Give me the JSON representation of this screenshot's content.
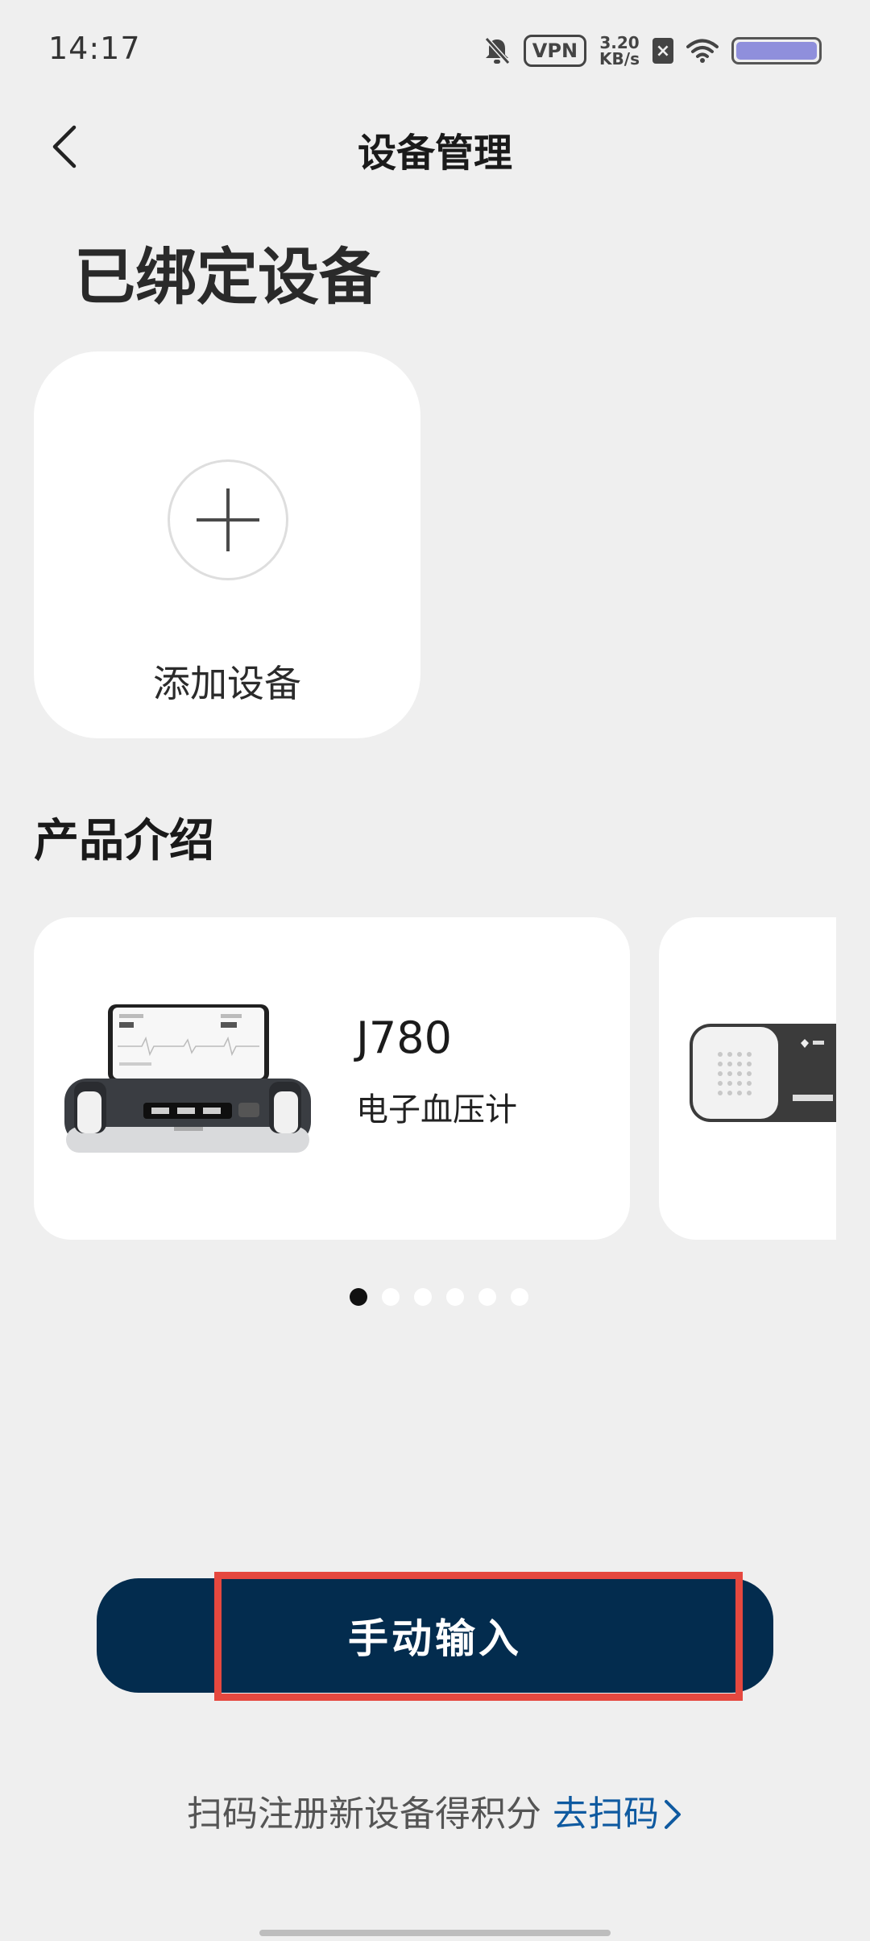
{
  "status_bar": {
    "time": "14:17",
    "vpn": "VPN",
    "speed_value": "3.20",
    "speed_unit": "KB/s",
    "sim_label": "×",
    "battery_color": "#8f8fdc",
    "icons": [
      "bell-off-icon",
      "vpn-icon",
      "sim-x-icon",
      "wifi-icon",
      "battery-icon"
    ]
  },
  "nav": {
    "title": "设备管理",
    "back_icon": "chevron-left-icon"
  },
  "bound_section": {
    "title": "已绑定设备",
    "add_device_label": "添加设备",
    "add_icon": "plus-icon"
  },
  "products_section": {
    "title": "产品介绍",
    "items": [
      {
        "model": "J780",
        "desc": "电子血压计",
        "image": "blood-pressure-monitor-image"
      },
      {
        "model": "",
        "desc": "",
        "image": "ecg-device-image"
      }
    ],
    "page_count": 6,
    "active_page": 0
  },
  "actions": {
    "manual_input_label": "手动输入",
    "scan_hint": "扫码注册新设备得积分",
    "scan_link": "去扫码"
  },
  "colors": {
    "background": "#efefef",
    "primary_button": "#032c4e",
    "link": "#0f5aa0",
    "highlight": "#e5483f"
  }
}
